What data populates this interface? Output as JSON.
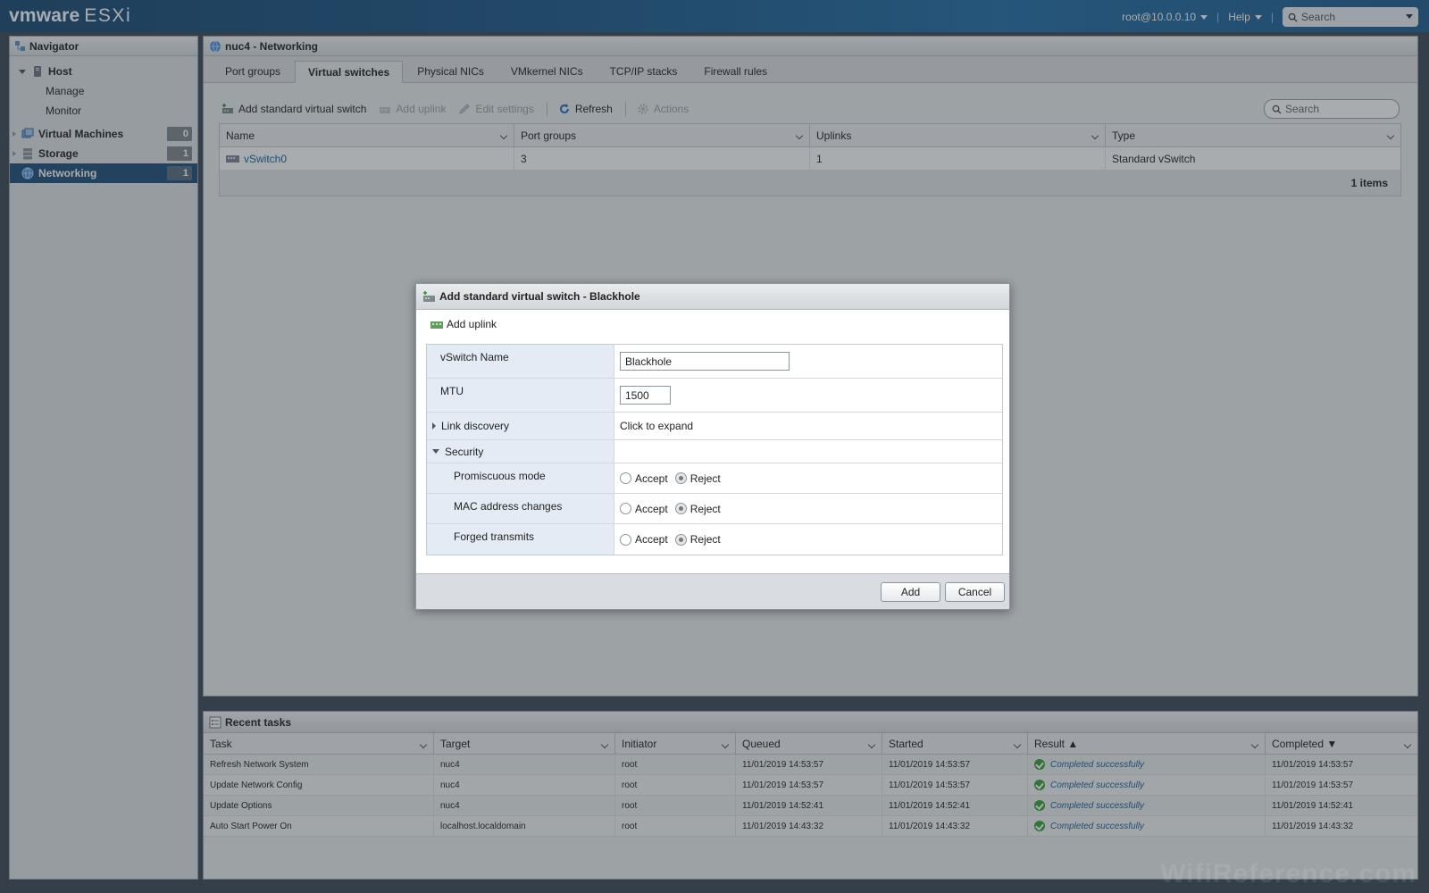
{
  "topbar": {
    "brand_vm": "vmware",
    "brand_product": "ESXi",
    "user": "root@10.0.0.10",
    "help": "Help",
    "search_placeholder": "Search"
  },
  "navigator": {
    "title": "Navigator",
    "host": "Host",
    "host_children": [
      "Manage",
      "Monitor"
    ],
    "groups": [
      {
        "label": "Virtual Machines",
        "count": "0"
      },
      {
        "label": "Storage",
        "count": "1"
      },
      {
        "label": "Networking",
        "count": "1"
      }
    ]
  },
  "main": {
    "title": "nuc4 - Networking",
    "tabs": [
      "Port groups",
      "Virtual switches",
      "Physical NICs",
      "VMkernel NICs",
      "TCP/IP stacks",
      "Firewall rules"
    ],
    "active_tab": "Virtual switches",
    "toolbar": {
      "add_switch": "Add standard virtual switch",
      "add_uplink": "Add uplink",
      "edit_settings": "Edit settings",
      "refresh": "Refresh",
      "actions": "Actions"
    },
    "search_placeholder": "Search",
    "grid": {
      "columns": [
        "Name",
        "Port groups",
        "Uplinks",
        "Type"
      ],
      "rows": [
        {
          "name": "vSwitch0",
          "port_groups": "3",
          "uplinks": "1",
          "type": "Standard vSwitch"
        }
      ],
      "footer": "1 items"
    }
  },
  "dialog": {
    "title": "Add standard virtual switch - Blackhole",
    "add_uplink": "Add uplink",
    "fields": {
      "vswitch_name_label": "vSwitch Name",
      "vswitch_name_value": "Blackhole",
      "mtu_label": "MTU",
      "mtu_value": "1500",
      "link_discovery_label": "Link discovery",
      "link_discovery_value": "Click to expand",
      "security_label": "Security"
    },
    "security_rows": [
      {
        "label": "Promiscuous mode",
        "accept": "Accept",
        "reject": "Reject"
      },
      {
        "label": "MAC address changes",
        "accept": "Accept",
        "reject": "Reject"
      },
      {
        "label": "Forged transmits",
        "accept": "Accept",
        "reject": "Reject"
      }
    ],
    "add_button": "Add",
    "cancel_button": "Cancel"
  },
  "tasks": {
    "title": "Recent tasks",
    "columns": [
      "Task",
      "Target",
      "Initiator",
      "Queued",
      "Started",
      "Result ▲",
      "Completed ▼"
    ],
    "rows": [
      {
        "task": "Refresh Network System",
        "target": "nuc4",
        "initiator": "root",
        "queued": "11/01/2019 14:53:57",
        "started": "11/01/2019 14:53:57",
        "result": "Completed successfully",
        "completed": "11/01/2019 14:53:57"
      },
      {
        "task": "Update Network Config",
        "target": "nuc4",
        "initiator": "root",
        "queued": "11/01/2019 14:53:57",
        "started": "11/01/2019 14:53:57",
        "result": "Completed successfully",
        "completed": "11/01/2019 14:53:57"
      },
      {
        "task": "Update Options",
        "target": "nuc4",
        "initiator": "root",
        "queued": "11/01/2019 14:52:41",
        "started": "11/01/2019 14:52:41",
        "result": "Completed successfully",
        "completed": "11/01/2019 14:52:41"
      },
      {
        "task": "Auto Start Power On",
        "target": "localhost.localdomain",
        "initiator": "root",
        "queued": "11/01/2019 14:43:32",
        "started": "11/01/2019 14:43:32",
        "result": "Completed successfully",
        "completed": "11/01/2019 14:43:32"
      }
    ]
  },
  "watermark": "WifiReference.com",
  "colors": {
    "accent": "#1f4f7b",
    "link": "#1c5e9c",
    "success": "#3aa13a"
  }
}
